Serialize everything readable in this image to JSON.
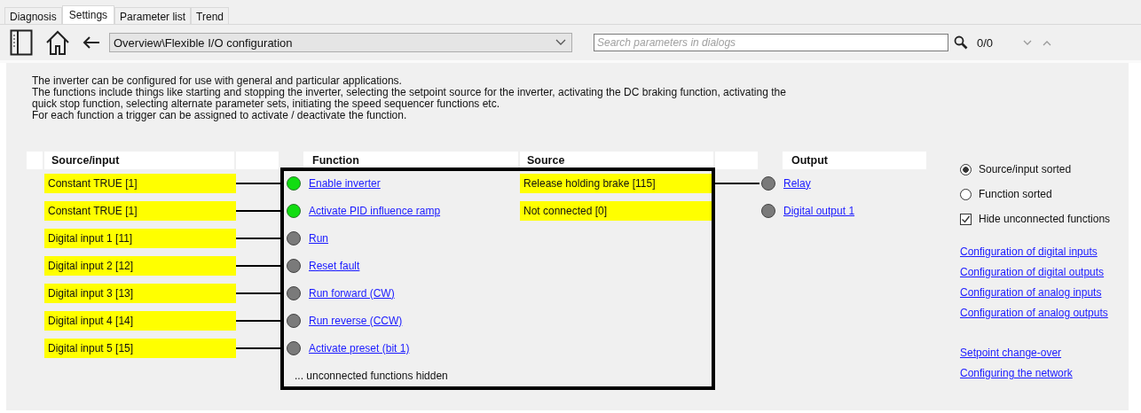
{
  "tabs": [
    {
      "label": "Diagnosis",
      "selected": false
    },
    {
      "label": "Settings",
      "selected": true
    },
    {
      "label": "Parameter list",
      "selected": false
    },
    {
      "label": "Trend",
      "selected": false
    }
  ],
  "toolbar": {
    "path": "Overview\\Flexible I/O configuration",
    "search": {
      "placeholder": "Search parameters in dialogs"
    },
    "match_count": "0/0"
  },
  "description": [
    "The inverter can be configured for use with general and particular applications.",
    "The functions include things like starting and stopping the inverter, selecting the setpoint source for the inverter, activating the DC braking function, activating the quick stop function, selecting alternate parameter sets, initiating the speed sequencer functions etc.",
    "For each function a trigger can be assigned to activate / deactivate the function."
  ],
  "diagram": {
    "columns": [
      "Source/input",
      "Function",
      "Source",
      "Output"
    ],
    "inputs": [
      {
        "source": "Constant TRUE [1]",
        "connected": true,
        "function": "Enable inverter",
        "active": true
      },
      {
        "source": "Constant TRUE [1]",
        "connected": true,
        "function": "Activate PID influence ramp",
        "active": true
      },
      {
        "source": "Digital input 1 [11]",
        "connected": true,
        "function": "Run",
        "active": false
      },
      {
        "source": "Digital input 2 [12]",
        "connected": true,
        "function": "Reset fault",
        "active": false
      },
      {
        "source": "Digital input 3 [13]",
        "connected": true,
        "function": "Run forward (CW)",
        "active": false
      },
      {
        "source": "Digital input 4 [14]",
        "connected": true,
        "function": "Run reverse (CCW)",
        "active": false
      },
      {
        "source": "Digital input 5 [15]",
        "connected": true,
        "function": "Activate preset (bit 1)",
        "active": false
      }
    ],
    "outputs": [
      {
        "source": "Release holding brake [115]",
        "connected": true,
        "output": "Relay",
        "active": false
      },
      {
        "source": "Not connected [0]",
        "connected": false,
        "output": "Digital output 1",
        "active": false
      }
    ],
    "footer": "... unconnected functions hidden"
  },
  "sort_options": [
    {
      "label": "Source/input sorted",
      "selected": true
    },
    {
      "label": "Function sorted",
      "selected": false
    }
  ],
  "hide_unconnected": {
    "label": "Hide unconnected functions",
    "checked": true
  },
  "link_groups": [
    [
      "Configuration of digital inputs",
      "Configuration of digital outputs",
      "Configuration of analog inputs",
      "Configuration of analog outputs"
    ],
    [
      "Setpoint change-over",
      "Configuring the network"
    ]
  ]
}
